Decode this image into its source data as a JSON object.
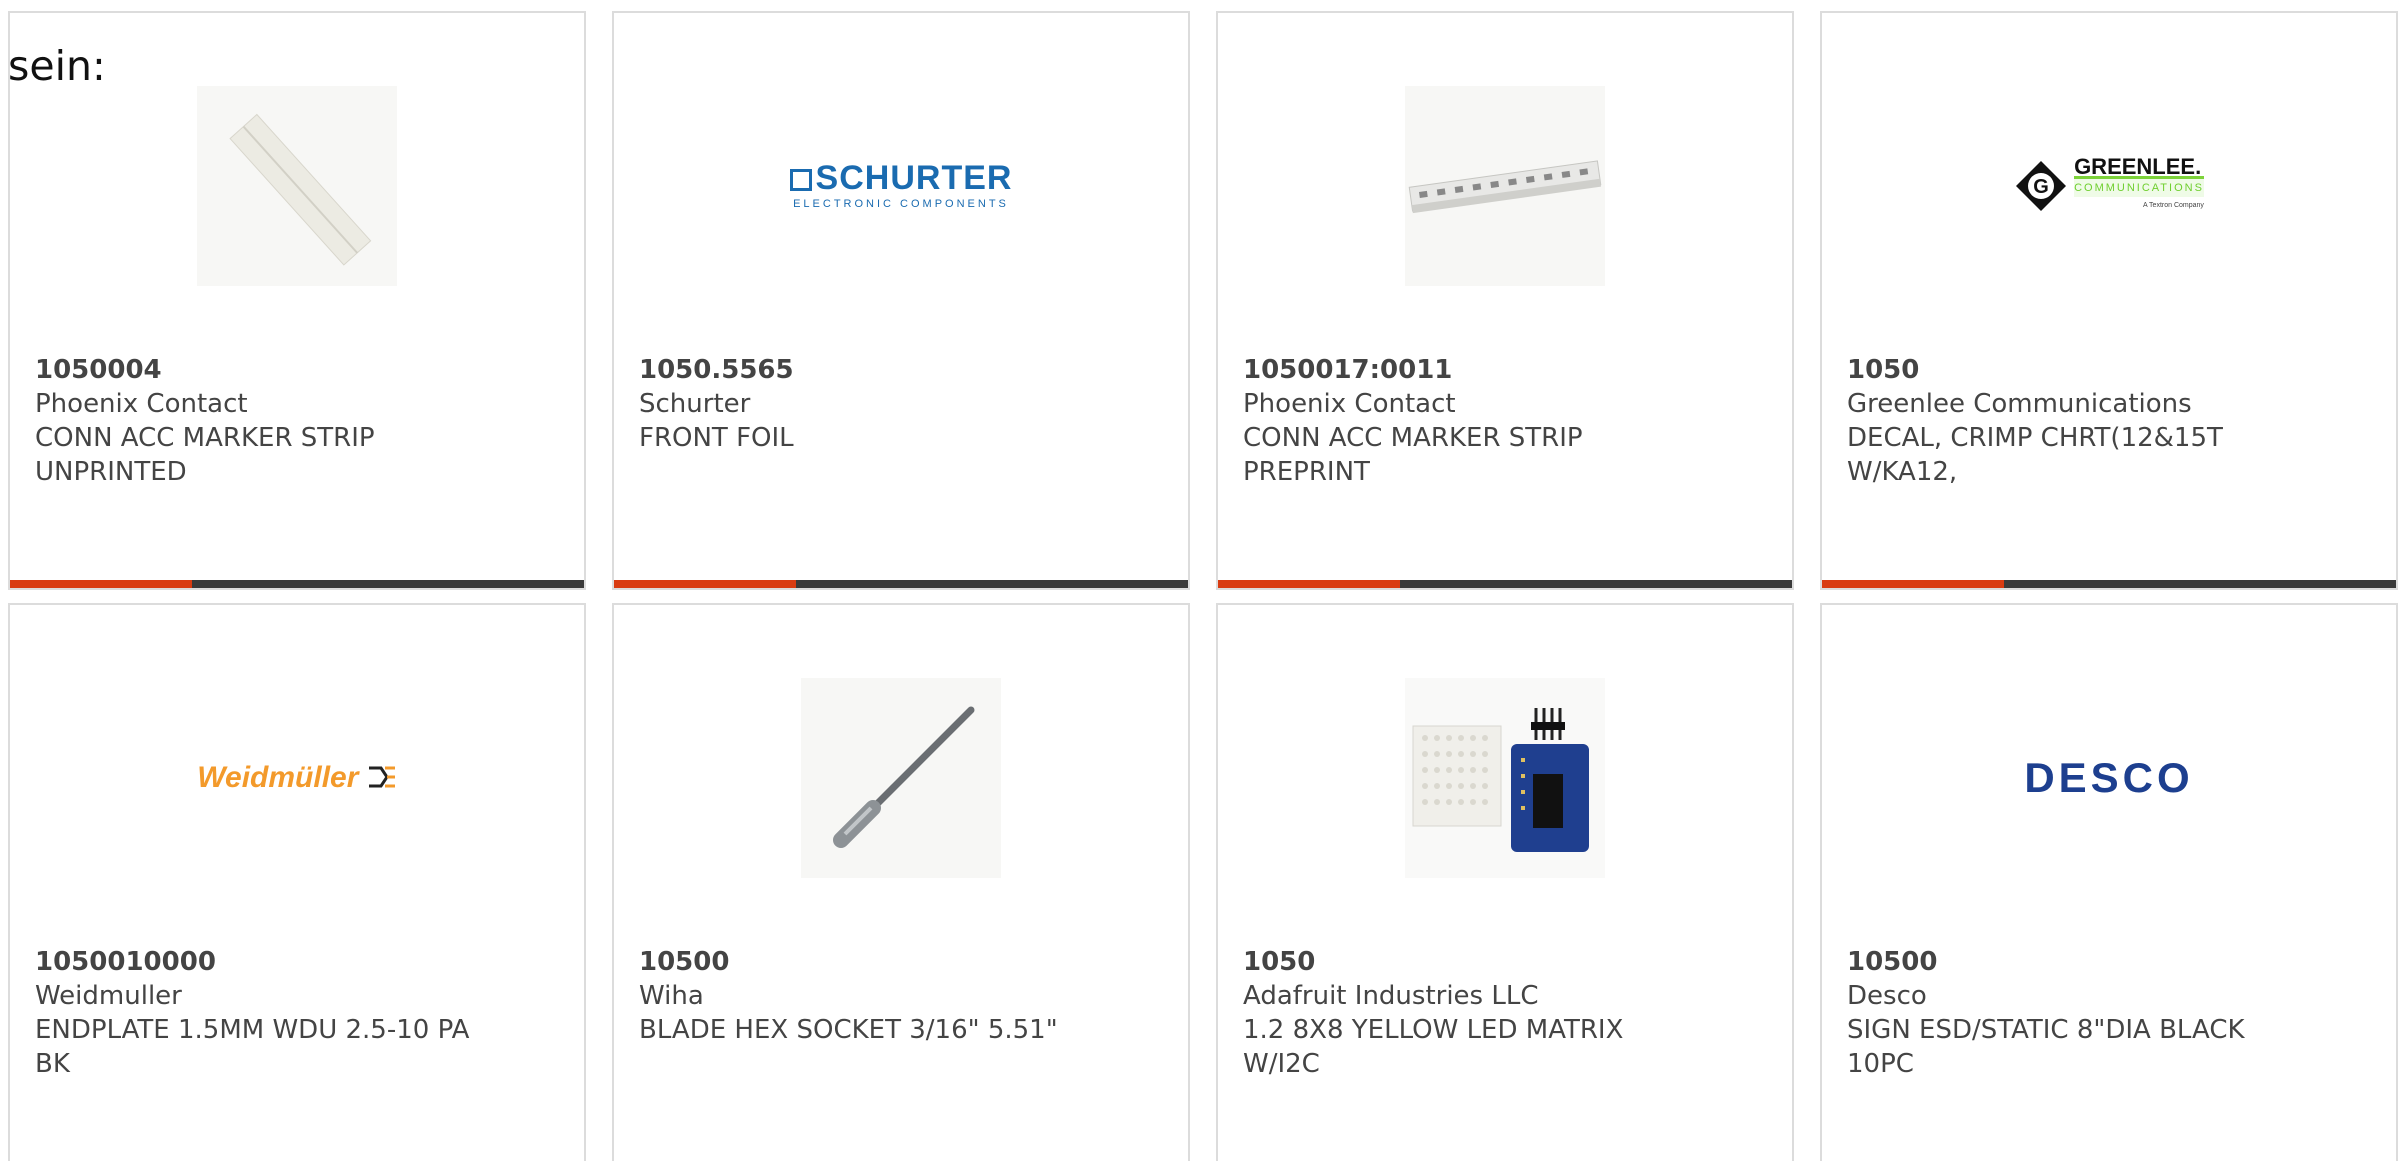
{
  "intro_text": "sein:",
  "products": [
    {
      "part_number": "1050004",
      "manufacturer": "Phoenix Contact",
      "description": "CONN ACC MARKER STRIP UNPRINTED",
      "image": "marker-strip-photo"
    },
    {
      "part_number": "1050.5565",
      "manufacturer": "Schurter",
      "description": "FRONT FOIL",
      "image": "schurter-logo",
      "logo_text": "SCHURTER",
      "logo_subtext": "ELECTRONIC COMPONENTS"
    },
    {
      "part_number": "1050017:0011",
      "manufacturer": "Phoenix Contact",
      "description": "CONN ACC MARKER STRIP PREPRINT",
      "image": "preprinted-marker-strip-photo"
    },
    {
      "part_number": "1050",
      "manufacturer": "Greenlee Communications",
      "description": "DECAL, CRIMP CHRT(12&15T W/KA12,",
      "image": "greenlee-logo",
      "logo_text": "GREENLEE.",
      "logo_subtext": "COMMUNICATIONS",
      "logo_tagline": "A Textron Company"
    },
    {
      "part_number": "1050010000",
      "manufacturer": "Weidmuller",
      "description": "ENDPLATE 1.5MM WDU 2.5-10 PA BK",
      "image": "weidmuller-logo",
      "logo_text": "Weidmüller"
    },
    {
      "part_number": "10500",
      "manufacturer": "Wiha",
      "description": "BLADE HEX SOCKET 3/16\" 5.51\"",
      "image": "hex-blade-photo"
    },
    {
      "part_number": "1050",
      "manufacturer": "Adafruit Industries LLC",
      "description": "1.2 8X8 YELLOW LED MATRIX W/I2C",
      "image": "led-matrix-photo"
    },
    {
      "part_number": "10500",
      "manufacturer": "Desco",
      "description": "SIGN ESD/STATIC 8\"DIA BLACK 10PC",
      "image": "desco-logo",
      "logo_text": "DESCO"
    }
  ],
  "colors": {
    "accent": "#d93c12",
    "bar": "#3a3a3a",
    "border": "#dcdcdc",
    "text": "#444444"
  }
}
